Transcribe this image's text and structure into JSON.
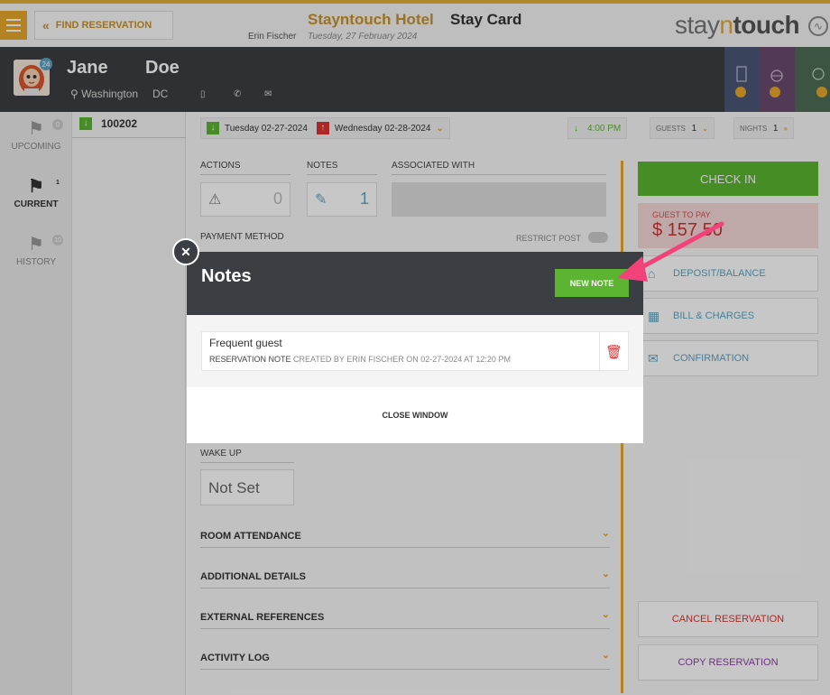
{
  "topbar": {
    "find_label": "FIND RESERVATION",
    "hotel_name": "Stayntouch Hotel",
    "page_title": "Stay Card",
    "user_name": "Erin Fischer",
    "date": "Tuesday, 27 February 2024",
    "brand_pre": "stay",
    "brand_mid": "n",
    "brand_post": "touch"
  },
  "guest": {
    "first_name": "Jane",
    "last_name": "Doe",
    "city": "Washington",
    "state": "DC",
    "avatar_badge": "24"
  },
  "nav": {
    "items": [
      {
        "label": "UPCOMING",
        "badge": "0"
      },
      {
        "label": "CURRENT",
        "badge": "1"
      },
      {
        "label": "HISTORY",
        "badge": "10"
      }
    ]
  },
  "reservation": {
    "number": "100202",
    "arrival": "Tuesday 02-27-2024",
    "departure": "Wednesday 02-28-2024",
    "time": "4:00 PM",
    "guests_label": "GUESTS",
    "guests": "1",
    "nights_label": "NIGHTS",
    "nights": "1"
  },
  "panel": {
    "actions_label": "ACTIONS",
    "actions_count": "0",
    "notes_label": "NOTES",
    "notes_count": "1",
    "associated_label": "ASSOCIATED WITH",
    "payment_label": "PAYMENT METHOD",
    "restrict_label": "RESTRICT POST",
    "wakeup_label": "WAKE UP",
    "wakeup_value": "Not Set",
    "sections": [
      "ROOM ATTENDANCE",
      "ADDITIONAL DETAILS",
      "EXTERNAL REFERENCES",
      "ACTIVITY LOG"
    ]
  },
  "right": {
    "checkin": "CHECK IN",
    "guest_to_pay_label": "GUEST TO PAY",
    "guest_to_pay": "$ 157.50",
    "deposit": "DEPOSIT/BALANCE",
    "bill": "BILL & CHARGES",
    "confirmation": "CONFIRMATION",
    "cancel": "CANCEL RESERVATION",
    "copy": "COPY RESERVATION"
  },
  "modal": {
    "title": "Notes",
    "new_note": "NEW NOTE",
    "note_text": "Frequent guest",
    "note_type": "RESERVATION NOTE",
    "note_meta": " CREATED BY ERIN FISCHER ON 02-27-2024 AT 12:20 PM",
    "close_window": "CLOSE WINDOW"
  },
  "colors": {
    "accent": "#e8a72b",
    "green": "#5cb531",
    "dark": "#3b3e42",
    "red": "#d33333",
    "blue": "#5aa6c4",
    "arrow": "#f2427a"
  }
}
